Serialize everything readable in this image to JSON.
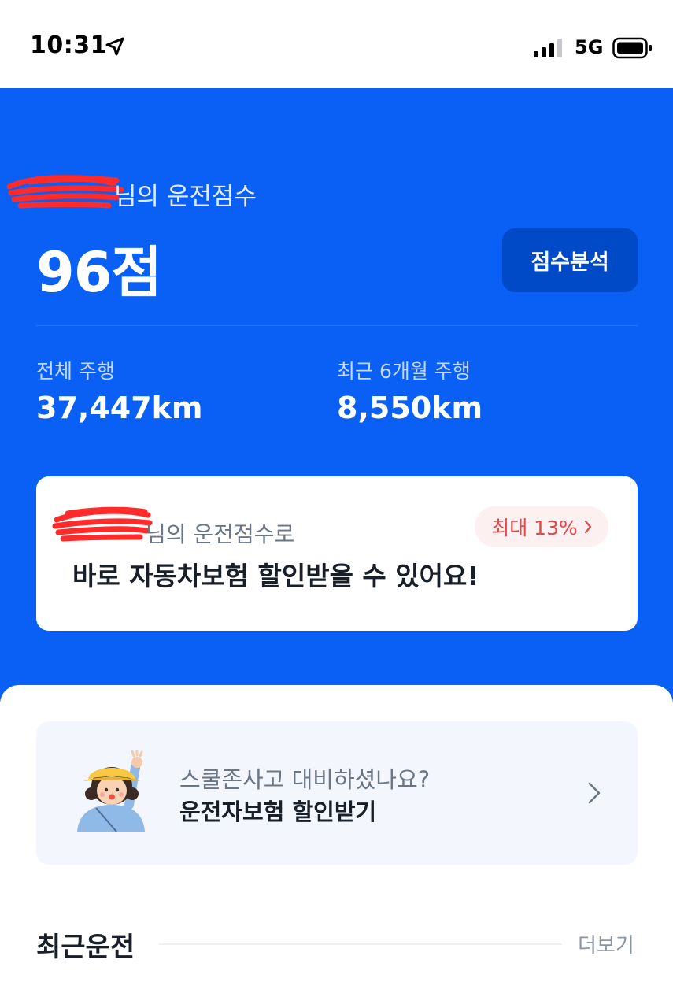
{
  "status_bar": {
    "time": "10:31",
    "network": "5G",
    "icons": [
      "location-arrow-icon",
      "signal-bars-icon",
      "battery-icon"
    ]
  },
  "score": {
    "label_suffix": "님의 운전점수",
    "value": "96점",
    "analysis_button": "점수분석"
  },
  "stats": {
    "total_label": "전체 주행",
    "total_value": "37,447km",
    "recent_label": "최근 6개월 주행",
    "recent_value": "8,550km"
  },
  "discount_card": {
    "subtitle_suffix": "님의 운전점수로",
    "title": "바로 자동차보험 할인받을 수 있어요!",
    "badge": "최대 13%"
  },
  "promo_card": {
    "subtitle": "스쿨존사고 대비하셨나요?",
    "title": "운전자보험 할인받기",
    "icon": "child-waving-illustration"
  },
  "recent": {
    "title": "최근운전",
    "more": "더보기"
  },
  "colors": {
    "brand_blue": "#0a5ff5",
    "button_blue": "#0049c7",
    "badge_red": "#e24a4a"
  }
}
